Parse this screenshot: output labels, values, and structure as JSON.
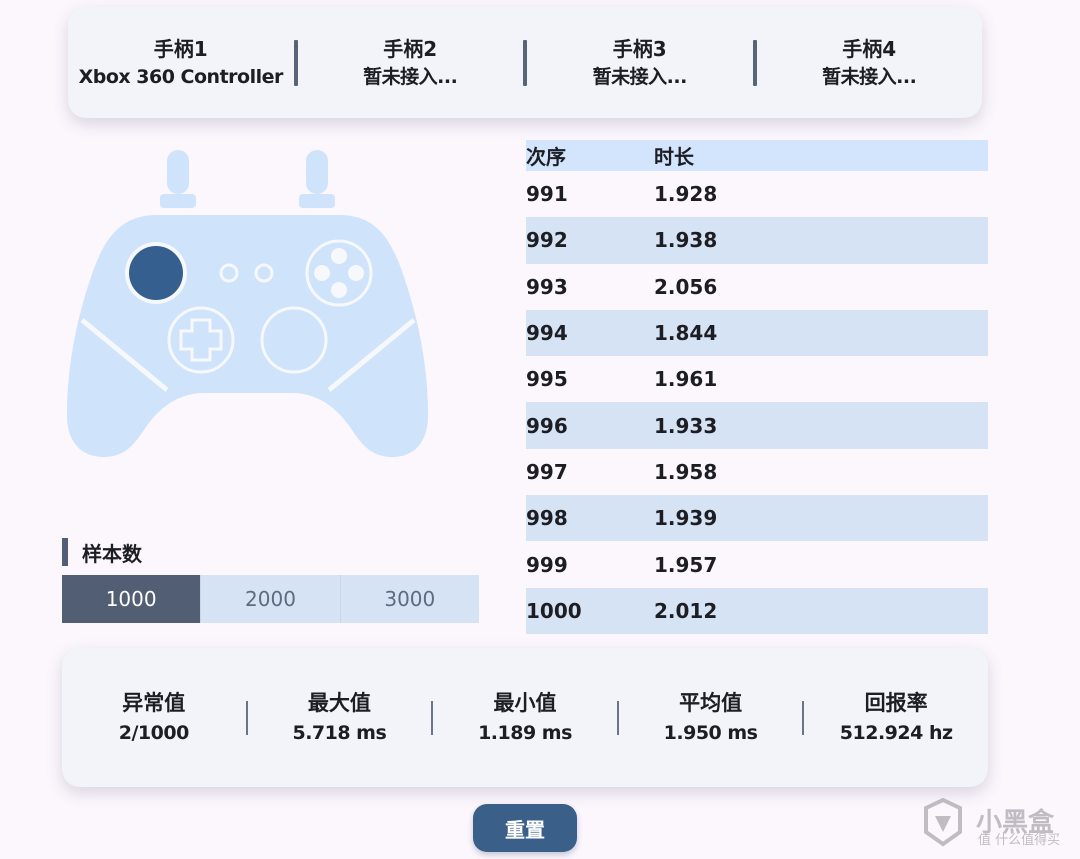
{
  "controllers": [
    {
      "name": "手柄1",
      "status": "Xbox 360 Controller"
    },
    {
      "name": "手柄2",
      "status": "暂未接入..."
    },
    {
      "name": "手柄3",
      "status": "暂未接入..."
    },
    {
      "name": "手柄4",
      "status": "暂未接入..."
    }
  ],
  "samples": {
    "title": "样本数",
    "options": [
      "1000",
      "2000",
      "3000"
    ],
    "selected": "1000"
  },
  "table": {
    "headers": [
      "次序",
      "时长"
    ],
    "rows": [
      [
        "991",
        "1.928"
      ],
      [
        "992",
        "1.938"
      ],
      [
        "993",
        "2.056"
      ],
      [
        "994",
        "1.844"
      ],
      [
        "995",
        "1.961"
      ],
      [
        "996",
        "1.933"
      ],
      [
        "997",
        "1.958"
      ],
      [
        "998",
        "1.939"
      ],
      [
        "999",
        "1.957"
      ],
      [
        "1000",
        "2.012"
      ]
    ]
  },
  "stats": [
    {
      "label": "异常值",
      "value": "2/1000"
    },
    {
      "label": "最大值",
      "value": "5.718 ms"
    },
    {
      "label": "最小值",
      "value": "1.189 ms"
    },
    {
      "label": "平均值",
      "value": "1.950 ms"
    },
    {
      "label": "回报率",
      "value": "512.924 hz"
    }
  ],
  "reset_label": "重置",
  "watermark": {
    "main": "小黑盒",
    "sub": "值 什么值得买"
  },
  "colors": {
    "accent": "#3a5f89",
    "pad": "#cfe3fb",
    "active_stick": "#355f8f",
    "segment_active": "#525e73"
  },
  "icons": {
    "gamepad": "gamepad-icon",
    "watermark": "heybox-logo-icon"
  }
}
